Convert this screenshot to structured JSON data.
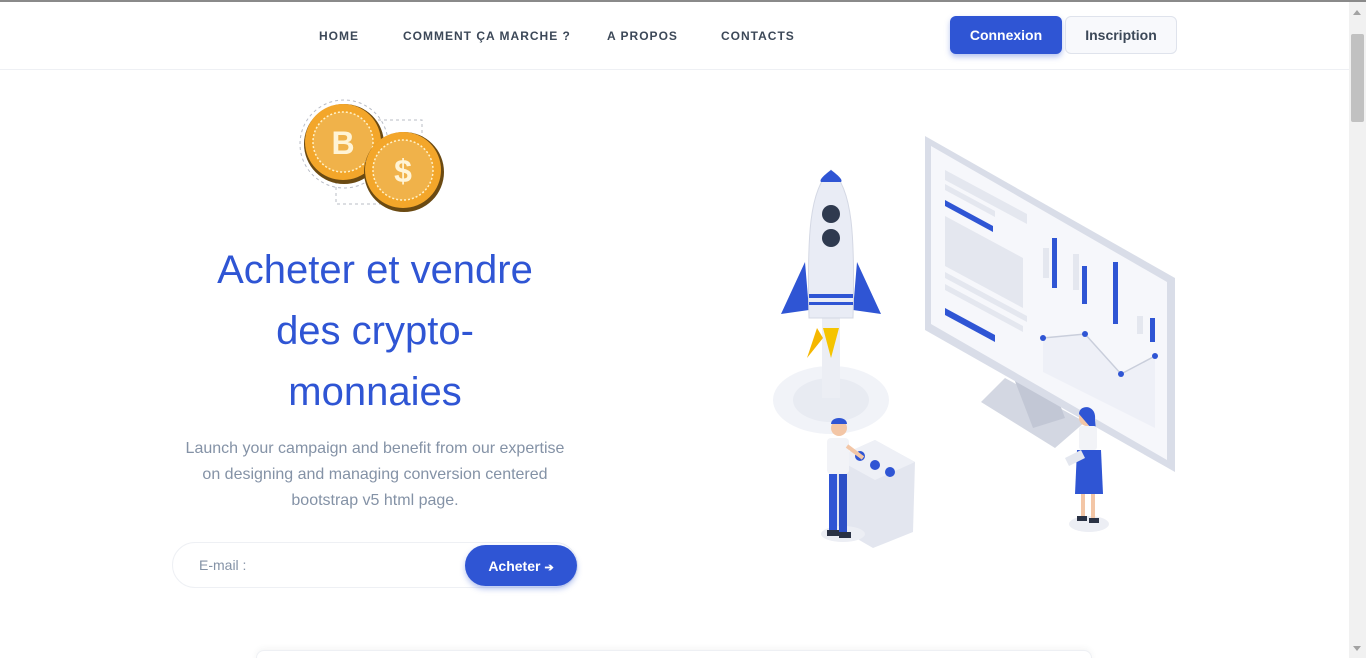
{
  "nav": {
    "links": [
      "HOME",
      "COMMENT ÇA MARCHE ?",
      "A PROPOS",
      "CONTACTS"
    ],
    "login_label": "Connexion",
    "signup_label": "Inscription"
  },
  "hero": {
    "title_line1": "Acheter et vendre",
    "title_line2": "des crypto-",
    "title_line3": "monnaies",
    "desc_line1": "Launch your campaign and benefit from our expertise",
    "desc_line2": "on designing and managing conversion centered",
    "desc_line3": "bootstrap v5 html page.",
    "email_placeholder": "E-mail :",
    "buy_label": "Acheter",
    "buy_icon": "arrow-right-icon"
  },
  "coins": {
    "left_symbol": "B",
    "right_symbol": "$"
  },
  "colors": {
    "primary": "#2f55d4",
    "muted": "#8492a6",
    "dark": "#3c4858",
    "coin": "#f0a82c"
  }
}
